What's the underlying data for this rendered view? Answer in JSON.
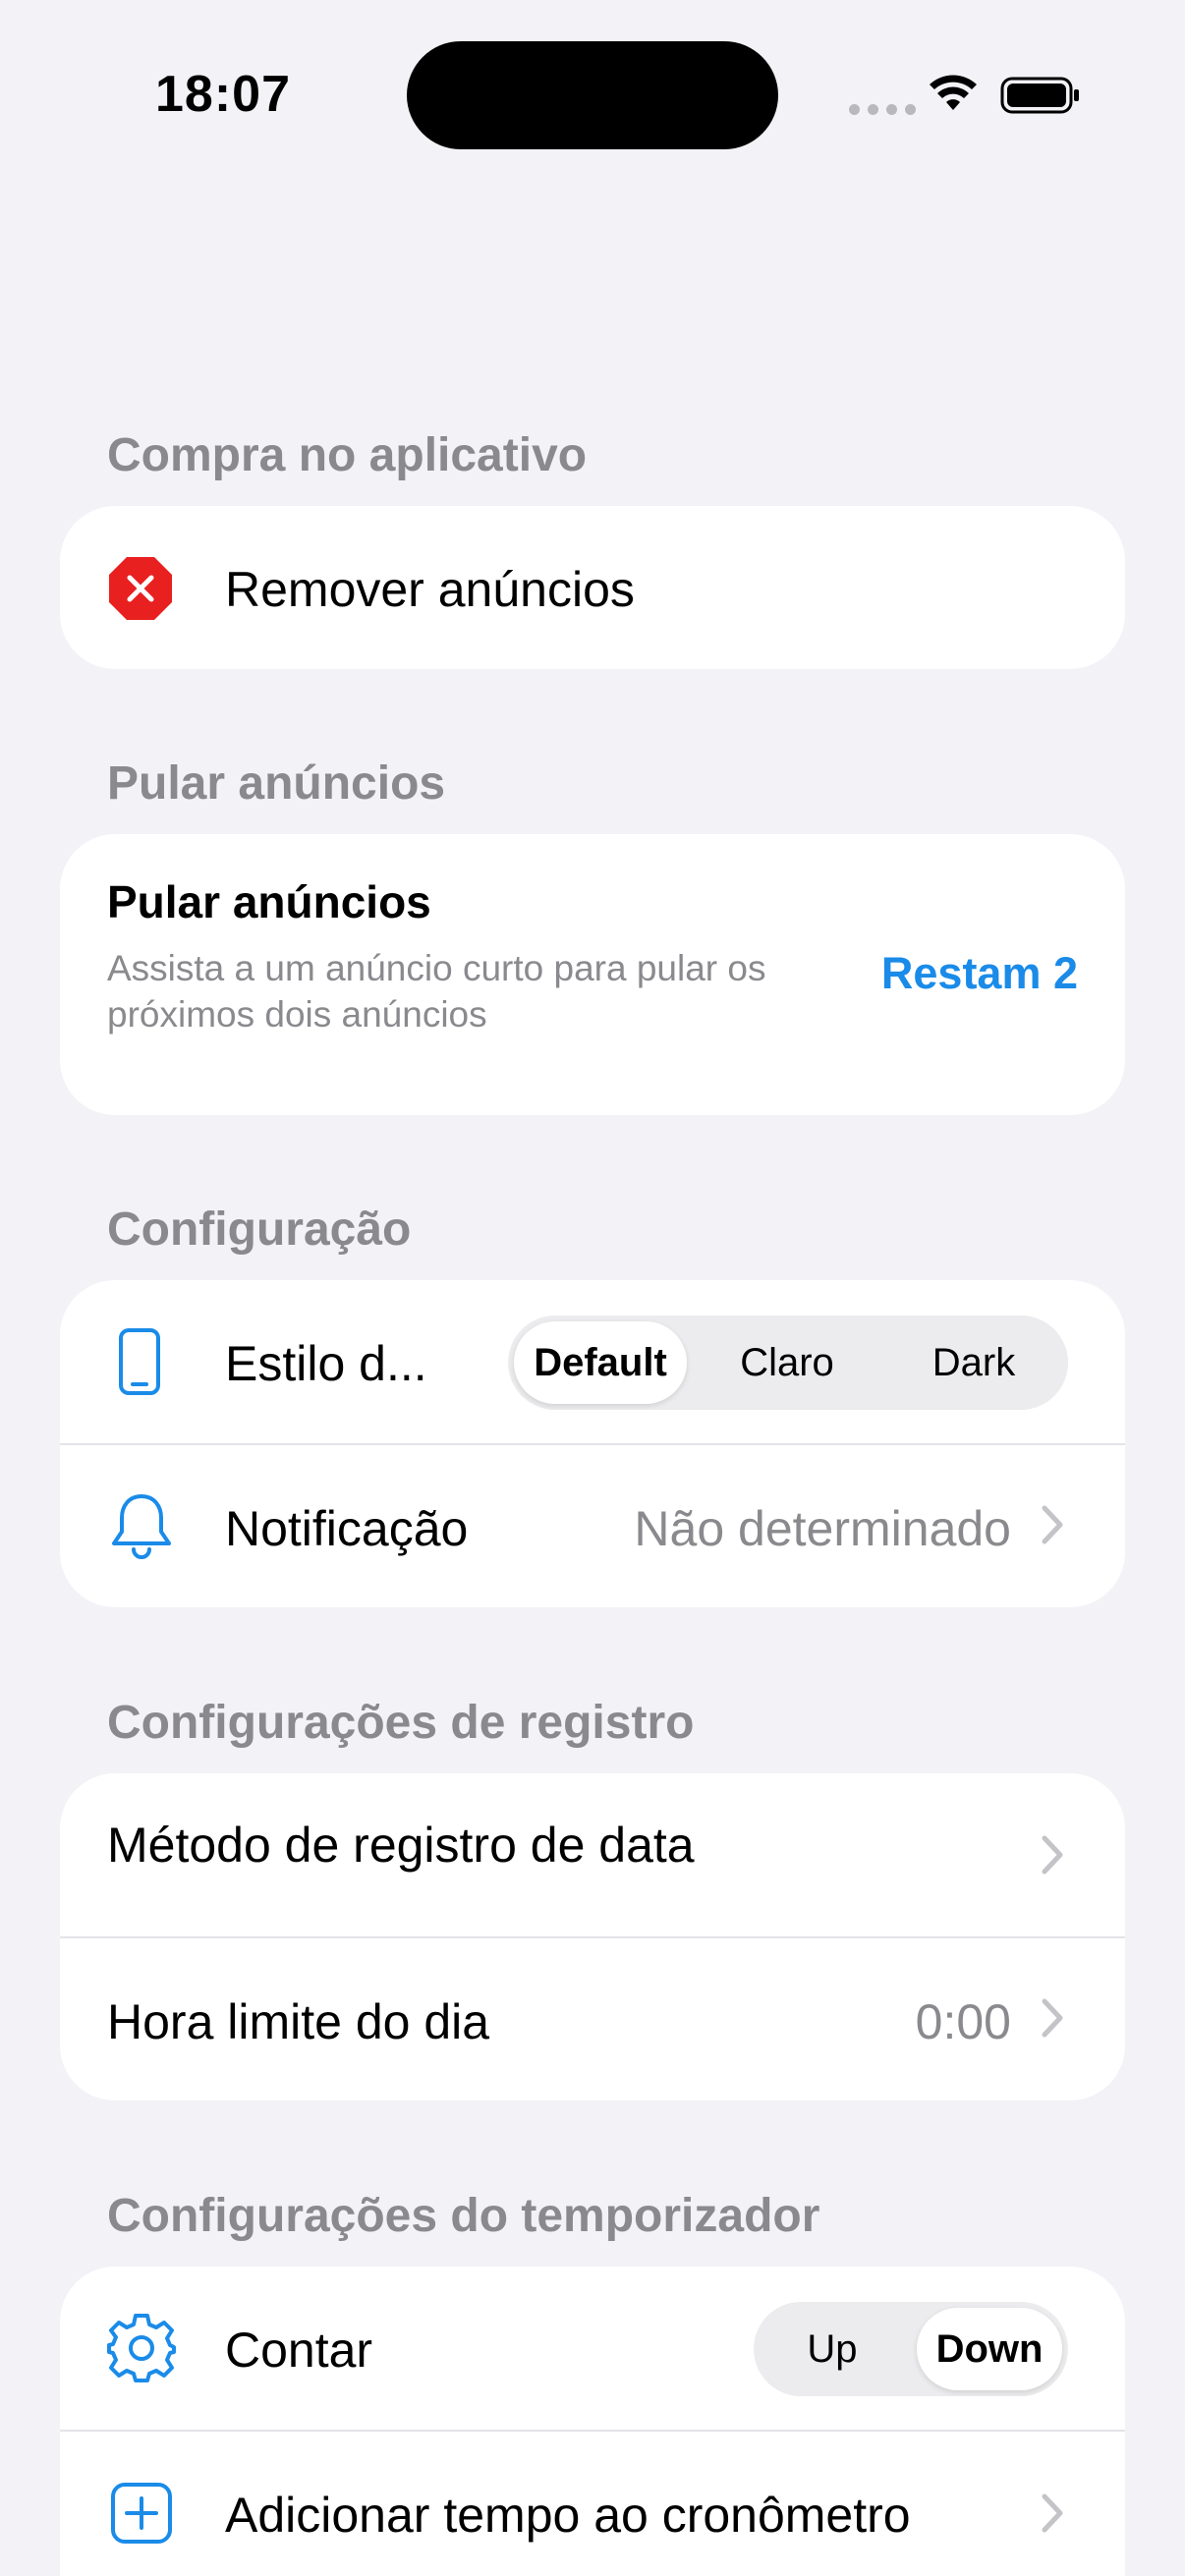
{
  "status_bar": {
    "time": "18:07"
  },
  "sections": {
    "in_app_purchase": {
      "header": "Compra no aplicativo",
      "remove_ads_label": "Remover anúncios",
      "icon": "close-octagon-icon",
      "icon_color": "#e8201f"
    },
    "skip_ads": {
      "header": "Pular anúncios",
      "title": "Pular anúncios",
      "description_line1": "Assista a um anúncio curto para pular os",
      "description_line2": "próximos dois anúncios",
      "action_label": "Restam 2",
      "action_color": "#1a8be8"
    },
    "configuration": {
      "header": "Configuração",
      "style_label": "Estilo d...",
      "style_options": [
        "Default",
        "Claro",
        "Dark"
      ],
      "style_selected": "Default",
      "notification_label": "Notificação",
      "notification_value": "Não determinado"
    },
    "record_settings": {
      "header": "Configurações de registro",
      "date_method_label": "Método de registro de data",
      "day_limit_label": "Hora limite do dia",
      "day_limit_value": "0:00"
    },
    "timer_settings": {
      "header": "Configurações do temporizador",
      "count_label": "Contar",
      "count_options": [
        "Up",
        "Down"
      ],
      "count_selected": "Down",
      "add_time_label": "Adicionar tempo ao cronômetro"
    }
  },
  "accent_color": "#1a8be8"
}
